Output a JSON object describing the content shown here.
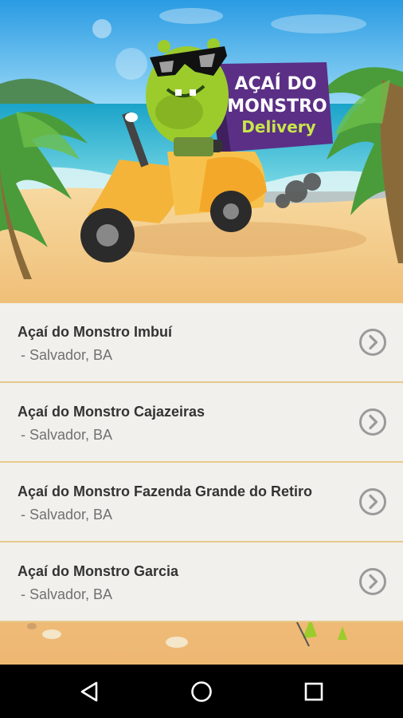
{
  "banner": {
    "logo_line1": "AÇAÍ DO",
    "logo_line2": "MONSTRO",
    "logo_line3": "Delivery"
  },
  "stores": [
    {
      "name": "Açaí do Monstro Imbuí",
      "city": " - Salvador, BA"
    },
    {
      "name": "Açaí do Monstro Cajazeiras",
      "city": " - Salvador, BA"
    },
    {
      "name": "Açaí do Monstro Fazenda Grande do Retiro",
      "city": " - Salvador, BA"
    },
    {
      "name": "Açaí do Monstro Garcia",
      "city": " - Salvador, BA"
    }
  ],
  "icons": {
    "row_action": "chevron-right-circle-icon",
    "nav_back": "back-triangle-icon",
    "nav_home": "home-circle-icon",
    "nav_recents": "recents-square-icon"
  },
  "colors": {
    "list_bg": "#f1f0ec",
    "divider": "#e7c98d",
    "title_text": "#333333",
    "subtitle_text": "#707070",
    "logo_purple": "#5b2f86",
    "scooter_yellow": "#f4b43a",
    "monster_green": "#9ccc2c"
  }
}
